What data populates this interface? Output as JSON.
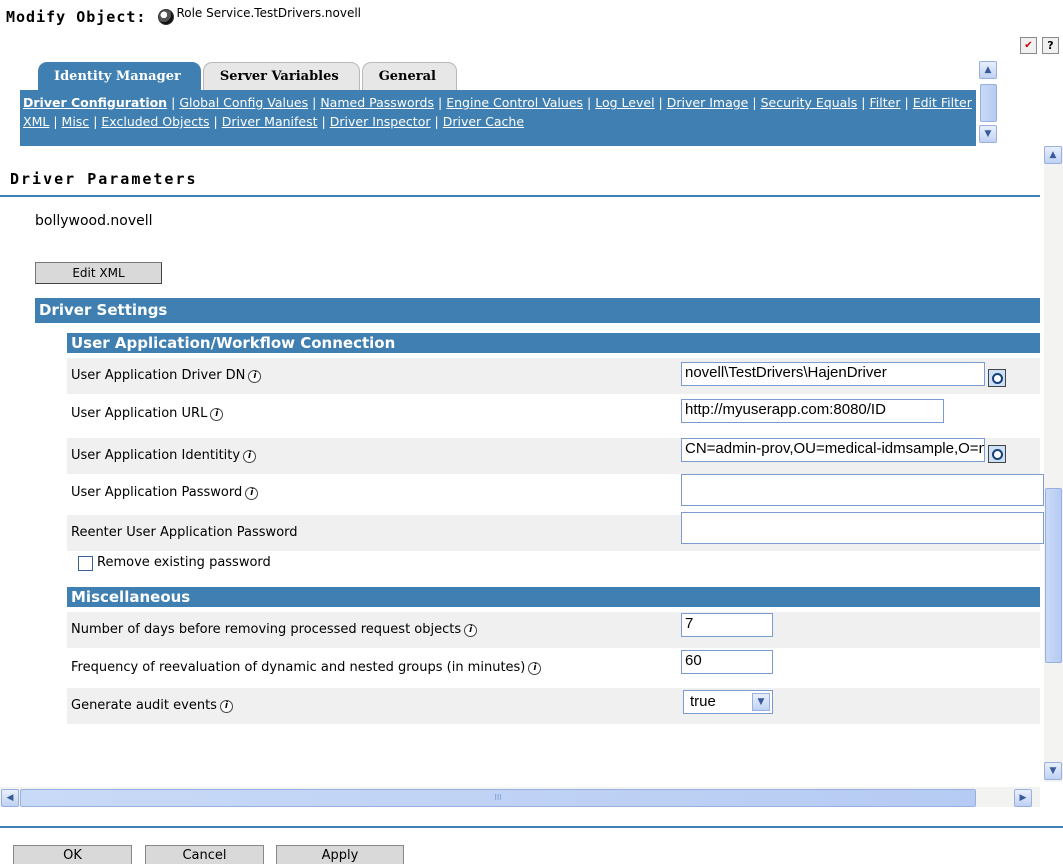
{
  "header": {
    "label": "Modify Object:",
    "object_name": "Role Service.TestDrivers.novell",
    "icons": [
      "object-icon",
      "tasks-icon",
      "help-icon"
    ],
    "help_glyph": "?",
    "tasks_glyph": "✔"
  },
  "tabs": [
    {
      "label": "Identity Manager",
      "active": true
    },
    {
      "label": "Server Variables",
      "active": false
    },
    {
      "label": "General",
      "active": false
    }
  ],
  "subnav": [
    {
      "label": "Driver Configuration",
      "current": true
    },
    {
      "label": "Global Config Values"
    },
    {
      "label": "Named Passwords"
    },
    {
      "label": "Engine Control Values"
    },
    {
      "label": "Log Level"
    },
    {
      "label": "Driver Image"
    },
    {
      "label": "Security Equals"
    },
    {
      "label": "Filter"
    },
    {
      "label": "Edit Filter XML"
    },
    {
      "label": "Misc"
    },
    {
      "label": "Excluded Objects"
    },
    {
      "label": "Driver Manifest"
    },
    {
      "label": "Driver Inspector"
    },
    {
      "label": "Driver Cache"
    }
  ],
  "main": {
    "title": "Driver Parameters",
    "driver_name": "bollywood.novell",
    "edit_xml_label": "Edit XML",
    "driver_settings_label": "Driver Settings"
  },
  "sections": {
    "uaw": "User Application/Workflow Connection",
    "misc": "Miscellaneous"
  },
  "fields": {
    "ua_driver_dn": {
      "label": "User Application Driver DN",
      "value": "novell\\TestDrivers\\HajenDriver"
    },
    "ua_url": {
      "label": "User Application URL",
      "value": "http://myuserapp.com:8080/ID"
    },
    "ua_identity": {
      "label": "User Application Identitity",
      "value": "CN=admin-prov,OU=medical-idmsample,O=novell"
    },
    "ua_password": {
      "label": "User Application Password",
      "value": ""
    },
    "ua_password_reenter": {
      "label": "Reenter User Application Password",
      "value": ""
    },
    "remove_password": {
      "label": "Remove existing password",
      "checked": false
    },
    "days_before_removing": {
      "label": "Number of days before removing processed request objects",
      "value": "7"
    },
    "reevaluation_frequency": {
      "label": "Frequency of reevaluation of dynamic and nested groups (in minutes)",
      "value": "60"
    },
    "audit_events": {
      "label": "Generate audit events",
      "value": "true"
    }
  },
  "info_glyph": "i",
  "hscroll_grip": "III",
  "buttons": {
    "ok": "OK",
    "cancel": "Cancel",
    "apply": "Apply"
  },
  "colors": {
    "accent": "#3f7fb1",
    "alt_row": "#f0f0f0"
  }
}
